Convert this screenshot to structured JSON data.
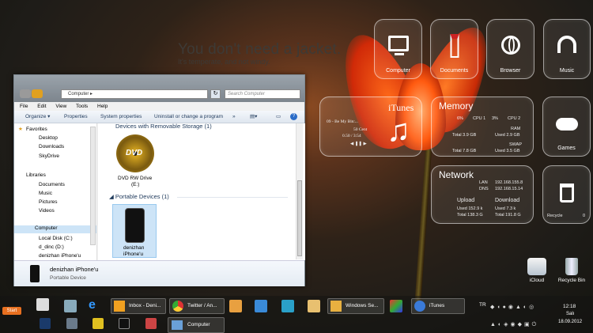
{
  "weather": {
    "headline": "You don't need a jacket.",
    "sub": "It's temperate, and not windy."
  },
  "tiles": {
    "computer": {
      "label": "Computer"
    },
    "documents": {
      "label": "Documents"
    },
    "browser": {
      "label": "Browser"
    },
    "music": {
      "label": "Music"
    },
    "games": {
      "label": "Games"
    },
    "recycle": {
      "label": "Recycle",
      "count": "0"
    }
  },
  "itunes": {
    "title": "iTunes",
    "track": "09 - Be My Bitc...",
    "artist": "50 Cent",
    "time": "0.50 / 3:54",
    "controls": "◀ ❚❚ ▶"
  },
  "memory": {
    "title": "Memory",
    "cpu1_pct": "6%",
    "cpu1_label": "CPU 1",
    "cpu2_pct": "3%",
    "cpu2_label": "CPU 2",
    "ram_label": "RAM",
    "ram_total": "Total 3.9 GB",
    "ram_used": "Used 2.9 GB",
    "swap_label": "SWAP",
    "swap_total": "Total 7.8 GB",
    "swap_used": "Used 3.5 GB"
  },
  "network": {
    "title": "Network",
    "lan_label": "LAN",
    "lan_ip": "192.168.155.8",
    "dns_label": "DNS",
    "dns_ip": "192.168.15.14",
    "upload_label": "Upload",
    "download_label": "Download",
    "up_used": "Used 152.9 k",
    "up_total": "Total 138.3 G",
    "down_used": "Used 7.3 k",
    "down_total": "Total 191.8 G"
  },
  "explorer": {
    "address": "Computer ▸",
    "search_placeholder": "Search Computer",
    "menu": [
      "File",
      "Edit",
      "View",
      "Tools",
      "Help"
    ],
    "commands": {
      "organize": "Organize ▾",
      "properties": "Properties",
      "system": "System properties",
      "uninstall": "Uninstall or change a program",
      "more": "»"
    },
    "nav": {
      "favorites": "Favorites",
      "desktop": "Desktop",
      "downloads": "Downloads",
      "skydrive": "SkyDrive",
      "libraries": "Libraries",
      "documents": "Documents",
      "music": "Music",
      "pictures": "Pictures",
      "videos": "Videos",
      "computer": "Computer",
      "local_c": "Local Disk (C:)",
      "d_dinc": "d_dinc (D:)",
      "iphone": "denizhan iPhone'u"
    },
    "group_removable": "Devices with Removable Storage (1)",
    "dvd_label": "DVD RW Drive",
    "dvd_letter": "(E:)",
    "dvd_text": "DVD",
    "group_portable": "◢ Portable Devices (1)",
    "iphone_label1": "denizhan",
    "iphone_label2": "iPhone'u",
    "details_name": "denizhan iPhone'u",
    "details_type": "Portable Device"
  },
  "desktop_icons": {
    "icloud": "iCloud",
    "recycle_bin": "Recycle Bin"
  },
  "taskbar": {
    "start": "Start",
    "inbox": "Inbox - Deni...",
    "twitter": "Twitter / An...",
    "windows_se": "Windows Se...",
    "itunes": "iTunes",
    "computer": "Computer",
    "lang": "TR",
    "time": "12:18",
    "day": "Salı",
    "date": "18.09.2012"
  }
}
